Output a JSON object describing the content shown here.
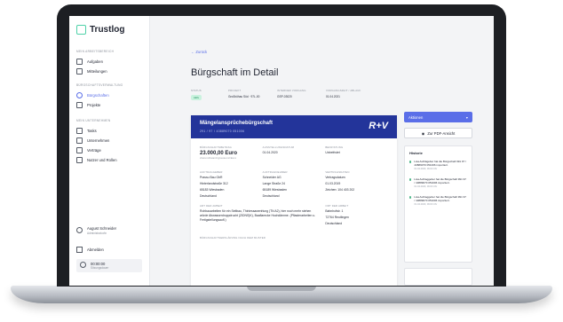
{
  "app": {
    "name": "Trustlog"
  },
  "sidebar": {
    "section1": "MEIN ARBEITSBEREICH",
    "items1": [
      {
        "label": "Aufgaben"
      },
      {
        "label": "Mitteilungen"
      }
    ],
    "section2": "BÜRGSCHAFTSVERWALTUNG",
    "items2": [
      {
        "label": "Bürgschaften"
      },
      {
        "label": "Projekte"
      }
    ],
    "section3": "MEIN UNTERNEHMEN",
    "items3": [
      {
        "label": "Tasks"
      },
      {
        "label": "Unternehmen"
      },
      {
        "label": "Verträge"
      },
      {
        "label": "Nutzer und Rollen"
      }
    ],
    "user": {
      "name": "August Schneider",
      "role": "Administrator/in"
    },
    "logout": "Abmelden",
    "clock": {
      "time": "00:00:00",
      "sub": "Sitzungsdauer"
    }
  },
  "page": {
    "back": "← Zurück",
    "title": "Bürgschaft im Detail",
    "meta": [
      {
        "key": "STATUS",
        "value": "Aktiv",
        "badge": true
      },
      {
        "key": "PROJEKT",
        "value": "Großbühau Süd · 97L-00",
        "link": true
      },
      {
        "key": "INTERNER VORGANG",
        "value": "GSP-03020"
      },
      {
        "key": "VORGANGSZEIT / ABLAUF",
        "value": "01.04.2021"
      }
    ]
  },
  "doc": {
    "title": "Mängelansprüchebürgschaft",
    "subtitle": "291 / 97 / 43889070 051006",
    "brand": "R+V",
    "row1": [
      {
        "key": "BÜRGSCHAFTSBETRAG",
        "value": "23.000,00 Euro",
        "note": "dreiundzwanzigtausend Euro"
      },
      {
        "key": "AUSSTELLUNGSDATUM",
        "value": "01.04.2020"
      },
      {
        "key": "BEFRISTUNG",
        "value": "Unbefristet"
      }
    ],
    "row2": [
      {
        "key": "AUFTRAGGEBER",
        "lines": [
          "Prassu Bau GbR",
          "Hinterlandstraße 312",
          "65183 Wiesbaden",
          "Deutschland"
        ]
      },
      {
        "key": "AUFTRAGNEHMER",
        "lines": [
          "Schneider AG",
          "Lange Straße 24",
          "65189 Wiesbaden",
          "Deutschland"
        ]
      },
      {
        "key": "VERTRAGSDATEN",
        "lines": [
          "Vertragsdatum:",
          "01.03.2019",
          "Zeichen: 104 403 202"
        ]
      }
    ],
    "row3": [
      {
        "key": "ART DER ARBEIT",
        "lines": [
          "Rohbauarbeiten für ein Seitbau, Thiniessawerirlung (TN A2), hier noch mehr stehen würde Abwasserdruppdrucht (ZIDNS)K), Baaflarecke Hochdämme. (Pflasterarbeiten u. Fertigstellungsaufl.)"
        ]
      },
      {
        "key": "ORT DER ARBEIT",
        "lines": [
          "Bahnhofstr. 1",
          "72764 Reutlingen",
          "Deutschland"
        ]
      }
    ],
    "row4_key": "BÜRGSCHAFTSERKLÄRUNG NACH DEM MUSTER"
  },
  "aside": {
    "actions": "Aktionen",
    "pdf": "Zur PDF-Ansicht",
    "history_title": "Historie",
    "history": [
      {
        "text": "Lisa Aufträgeber hat die Bürgschaft 991 97 / 43889070 051006 importiert.",
        "time": "01.04.2020, 09:00 Uhr"
      },
      {
        "text": "Lisa Auftraggeber hat die Bürgschaft 991 97 / 43889070 051006 importiert.",
        "time": "01.04.2020, 09:00 Uhr"
      },
      {
        "text": "Lisa Auftraggeber hat die Bürgschaft 991 97 / 43889070 051006 importiert.",
        "time": "01.04.2020, 09:00 Uhr"
      }
    ]
  }
}
